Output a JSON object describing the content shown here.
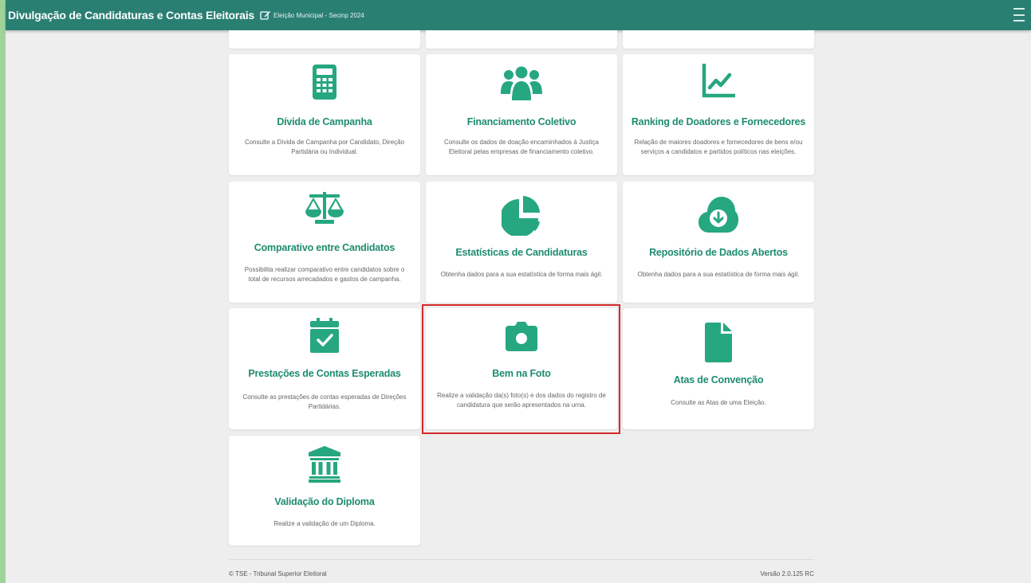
{
  "header": {
    "title": "Divulgação de Candidaturas e Contas Eleitorais",
    "election": "Eleição Municipal - Secinp 2024"
  },
  "colors": {
    "header_bg": "#2a7f73",
    "accent": "#26a77f",
    "title_green": "#1e8c6e",
    "highlight": "#d42a2a"
  },
  "cards": [
    {
      "icon": "calculator-icon",
      "title": "Dívida de Campanha",
      "desc": "Consulte a Dívida de Campanha por Candidato, Direção Partidária ou Individual."
    },
    {
      "icon": "users-icon",
      "title": "Financiamento Coletivo",
      "desc": "Consulte os dados de doação encaminhados à Justiça Eleitoral pelas empresas de financiamento coletivo."
    },
    {
      "icon": "line-chart-icon",
      "title": "Ranking de Doadores e Fornecedores",
      "desc": "Relação de maiores doadores e fornecedores de bens e/ou serviços a candidatos e partidos políticos nas eleições."
    },
    {
      "icon": "balance-scale-icon",
      "title": "Comparativo entre Candidatos",
      "desc": "Possibilita realizar comparativo entre candidatos sobre o total de recursos arrecadados e gastos de campanha."
    },
    {
      "icon": "pie-chart-icon",
      "title": "Estatísticas de Candidaturas",
      "desc": "Obtenha dados para a sua estatística de forma mais ágil."
    },
    {
      "icon": "cloud-download-icon",
      "title": "Repositório de Dados Abertos",
      "desc": "Obtenha dados para a sua estatística de forma mais ágil."
    },
    {
      "icon": "calendar-check-icon",
      "title": "Prestações de Contas Esperadas",
      "desc": "Consulte as prestações de contas esperadas de Direções Partidárias."
    },
    {
      "icon": "camera-icon",
      "title": "Bem na Foto",
      "desc": "Realize a validação da(s) foto(s) e dos dados do registro de candidatura que serão apresentados na urna."
    },
    {
      "icon": "file-icon",
      "title": "Atas de Convenção",
      "desc": "Consulte as Atas de uma Eleição."
    },
    {
      "icon": "institution-icon",
      "title": "Validação do Diploma",
      "desc": "Realize a validação de um Diploma."
    }
  ],
  "footer": {
    "copyright": "© TSE - Tribunal Superior Eleitoral",
    "version": "Versão 2.0.125 RC"
  }
}
